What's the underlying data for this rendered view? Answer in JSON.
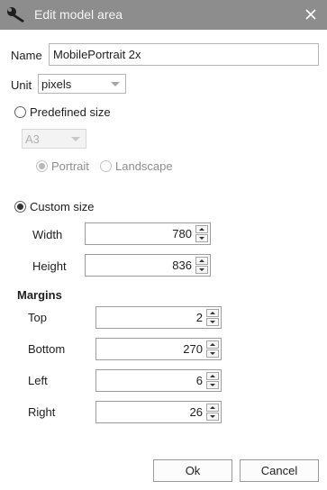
{
  "window": {
    "title": "Edit model area",
    "icons": {
      "app": "wrench-icon",
      "close": "close-icon"
    }
  },
  "form": {
    "name_label": "Name",
    "name_value": "MobilePortrait 2x",
    "unit_label": "Unit",
    "unit_value": "pixels",
    "predefined": {
      "label": "Predefined size",
      "selected": false,
      "size_value": "A3",
      "orientation": {
        "portrait_label": "Portrait",
        "landscape_label": "Landscape",
        "selected": "portrait"
      }
    },
    "custom": {
      "label": "Custom size",
      "selected": true,
      "width_label": "Width",
      "width_value": "780",
      "height_label": "Height",
      "height_value": "836"
    },
    "margins": {
      "title": "Margins",
      "top_label": "Top",
      "top_value": "2",
      "bottom_label": "Bottom",
      "bottom_value": "270",
      "left_label": "Left",
      "left_value": "6",
      "right_label": "Right",
      "right_value": "26"
    }
  },
  "buttons": {
    "ok": "Ok",
    "cancel": "Cancel"
  },
  "colors": {
    "titlebar": "#8d8d8d",
    "background": "#ffffff",
    "border": "#b4b4b4"
  }
}
